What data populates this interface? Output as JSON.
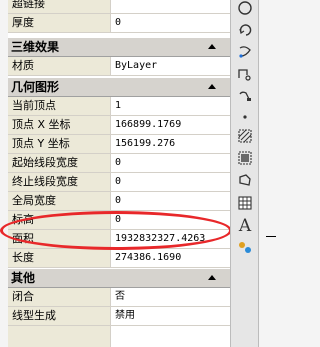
{
  "panel": {
    "top_rows": [
      {
        "label": "超链接",
        "value": ""
      },
      {
        "label": "厚度",
        "value": "0"
      }
    ],
    "sections": [
      {
        "title": "三维效果",
        "rows": [
          {
            "label": "材质",
            "value": "ByLayer"
          }
        ]
      },
      {
        "title": "几何图形",
        "rows": [
          {
            "label": "当前顶点",
            "value": "1"
          },
          {
            "label": "顶点 X 坐标",
            "value": "166899.1769"
          },
          {
            "label": "顶点 Y 坐标",
            "value": "156199.276"
          },
          {
            "label": "起始线段宽度",
            "value": "0"
          },
          {
            "label": "终止线段宽度",
            "value": "0"
          },
          {
            "label": "全局宽度",
            "value": "0"
          },
          {
            "label": "标高",
            "value": "0"
          },
          {
            "label": "面积",
            "value": "1932832327.4263"
          },
          {
            "label": "长度",
            "value": "274386.1690"
          }
        ]
      },
      {
        "title": "其他",
        "rows": [
          {
            "label": "闭合",
            "value": "否"
          },
          {
            "label": "线型生成",
            "value": "禁用"
          }
        ]
      }
    ]
  },
  "toolbar": {
    "icons": [
      "circle-icon",
      "rotate-icon",
      "move-icon",
      "copy-icon",
      "point-icon",
      "hatch-icon",
      "gradient-icon",
      "region-icon",
      "table-icon",
      "text-icon",
      "add-selected-icon"
    ],
    "text_tool_label": "A"
  },
  "highlight_color": "#e8282a"
}
